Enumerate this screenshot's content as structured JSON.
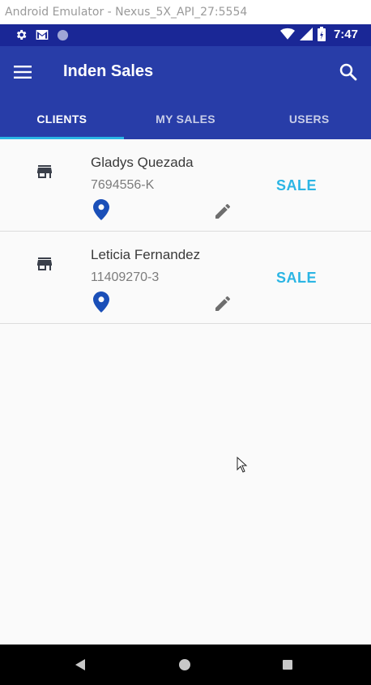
{
  "window": {
    "title": "Android Emulator - Nexus_5X_API_27:5554"
  },
  "status_bar": {
    "time": "7:47",
    "icons_left": [
      "gear-icon",
      "gmail-icon",
      "sync-circle-icon"
    ],
    "icons_right": [
      "wifi-icon",
      "signal-icon",
      "battery-icon"
    ]
  },
  "app_bar": {
    "title": "Inden Sales",
    "color": "#283da8",
    "status_color": "#1a2796",
    "accent": "#2bb5e4"
  },
  "tabs": [
    {
      "label": "CLIENTS",
      "active": true
    },
    {
      "label": "MY SALES",
      "active": false
    },
    {
      "label": "USERS",
      "active": false
    }
  ],
  "clients": [
    {
      "name": "Gladys Quezada",
      "id": "7694556-K",
      "action_label": "SALE"
    },
    {
      "name": "Leticia Fernandez",
      "id": "11409270-3",
      "action_label": "SALE"
    }
  ]
}
